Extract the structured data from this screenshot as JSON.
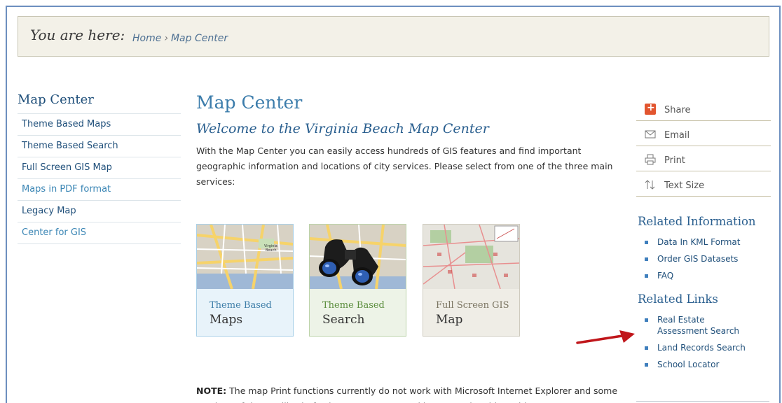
{
  "breadcrumb": {
    "label": "You are here:",
    "home": "Home",
    "separator": "›",
    "current": "Map Center"
  },
  "leftnav": {
    "title": "Map Center",
    "items": [
      {
        "label": "Theme Based Maps"
      },
      {
        "label": "Theme Based Search"
      },
      {
        "label": "Full Screen GIS Map"
      },
      {
        "label": "Maps in PDF format"
      },
      {
        "label": "Legacy Map"
      },
      {
        "label": "Center for GIS"
      }
    ]
  },
  "main": {
    "title": "Map Center",
    "subtitle": "Welcome to the Virginia Beach Map Center",
    "intro": "With the Map Center you can easily access hundreds of GIS features and find important geographic information and locations of city services.  Please select from one of the three main services:",
    "cards": [
      {
        "line1": "Theme Based",
        "line2": "Maps",
        "icon": "street-map-thumbnail"
      },
      {
        "line1": "Theme Based",
        "line2": "Search",
        "icon": "binoculars-thumbnail"
      },
      {
        "line1": "Full Screen GIS",
        "line2": "Map",
        "icon": "gis-map-thumbnail"
      }
    ],
    "note_label": "NOTE:",
    "note_text": "  The map Print functions currently do not work with Microsoft Internet Explorer and some versions of the Mozilla Firefox browser.  We are working to resolve this problem."
  },
  "tools": [
    {
      "label": "Share",
      "icon": "share-icon"
    },
    {
      "label": "Email",
      "icon": "email-icon"
    },
    {
      "label": "Print",
      "icon": "print-icon"
    },
    {
      "label": "Text Size",
      "icon": "text-size-icon"
    }
  ],
  "related_info": {
    "title": "Related Information",
    "items": [
      {
        "label": "Data In KML Format"
      },
      {
        "label": "Order GIS Datasets"
      },
      {
        "label": "FAQ"
      }
    ]
  },
  "related_links": {
    "title": "Related Links",
    "items": [
      {
        "label": "Real Estate Assessment Search"
      },
      {
        "label": "Land Records Search"
      },
      {
        "label": "School Locator"
      }
    ]
  },
  "colors": {
    "accent": "#3b7cab",
    "arrow": "#c0161b",
    "frame": "#6d8fbf"
  }
}
